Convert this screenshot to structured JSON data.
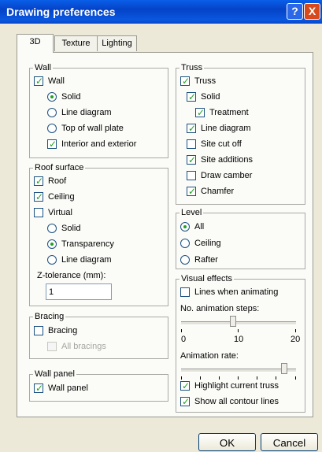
{
  "window": {
    "title": "Drawing preferences"
  },
  "titlebar": {
    "help_icon": "?",
    "close_icon": "X"
  },
  "tabs": [
    {
      "label": "3D"
    },
    {
      "label": "Texture"
    },
    {
      "label": "Lighting"
    }
  ],
  "wall": {
    "legend": "Wall",
    "items": [
      {
        "label": "Wall",
        "control": "checkbox",
        "checked": true
      },
      {
        "label": "Solid",
        "control": "radio",
        "checked": true
      },
      {
        "label": "Line diagram",
        "control": "radio",
        "checked": false
      },
      {
        "label": "Top of wall plate",
        "control": "radio",
        "checked": false
      },
      {
        "label": "Interior and exterior",
        "control": "checkbox",
        "checked": true
      }
    ]
  },
  "roof": {
    "legend": "Roof surface",
    "items": [
      {
        "label": "Roof",
        "control": "checkbox",
        "checked": true
      },
      {
        "label": "Ceiling",
        "control": "checkbox",
        "checked": true
      },
      {
        "label": "Virtual",
        "control": "checkbox",
        "checked": false
      },
      {
        "label": "Solid",
        "control": "radio",
        "checked": false
      },
      {
        "label": "Transparency",
        "control": "radio",
        "checked": true
      },
      {
        "label": "Line diagram",
        "control": "radio",
        "checked": false
      }
    ],
    "z_tolerance_label": "Z-tolerance (mm):",
    "z_tolerance_value": "1"
  },
  "bracing": {
    "legend": "Bracing",
    "items": [
      {
        "label": "Bracing",
        "control": "checkbox",
        "checked": false
      },
      {
        "label": "All bracings",
        "control": "checkbox",
        "checked": false,
        "disabled": true
      }
    ]
  },
  "wall_panel": {
    "legend": "Wall panel",
    "items": [
      {
        "label": "Wall panel",
        "control": "checkbox",
        "checked": true
      }
    ]
  },
  "truss": {
    "legend": "Truss",
    "items": [
      {
        "label": "Truss",
        "checked": true
      },
      {
        "label": "Solid",
        "checked": true
      },
      {
        "label": "Treatment",
        "checked": true
      },
      {
        "label": "Line diagram",
        "checked": true
      },
      {
        "label": "Site cut off",
        "checked": false
      },
      {
        "label": "Site additions",
        "checked": true
      },
      {
        "label": "Draw camber",
        "checked": false
      },
      {
        "label": "Chamfer",
        "checked": true
      }
    ]
  },
  "level": {
    "legend": "Level",
    "items": [
      {
        "label": "All",
        "checked": true
      },
      {
        "label": "Ceiling",
        "checked": false
      },
      {
        "label": "Rafter",
        "checked": false
      }
    ]
  },
  "visual": {
    "legend": "Visual effects",
    "lines_when_animating": {
      "label": "Lines when animating",
      "checked": false
    },
    "steps_label": "No. animation steps:",
    "steps": {
      "min": 0,
      "max": 20,
      "value": 9,
      "mid_label": "10",
      "min_label": "0",
      "max_label": "20"
    },
    "rate_label": "Animation rate:",
    "rate": {
      "value": 0.92
    },
    "highlight": {
      "label": "Highlight current truss",
      "checked": true
    },
    "contours": {
      "label": "Show all contour lines",
      "checked": true
    }
  },
  "footer": {
    "ok_label": "OK",
    "cancel_label": "Cancel"
  }
}
